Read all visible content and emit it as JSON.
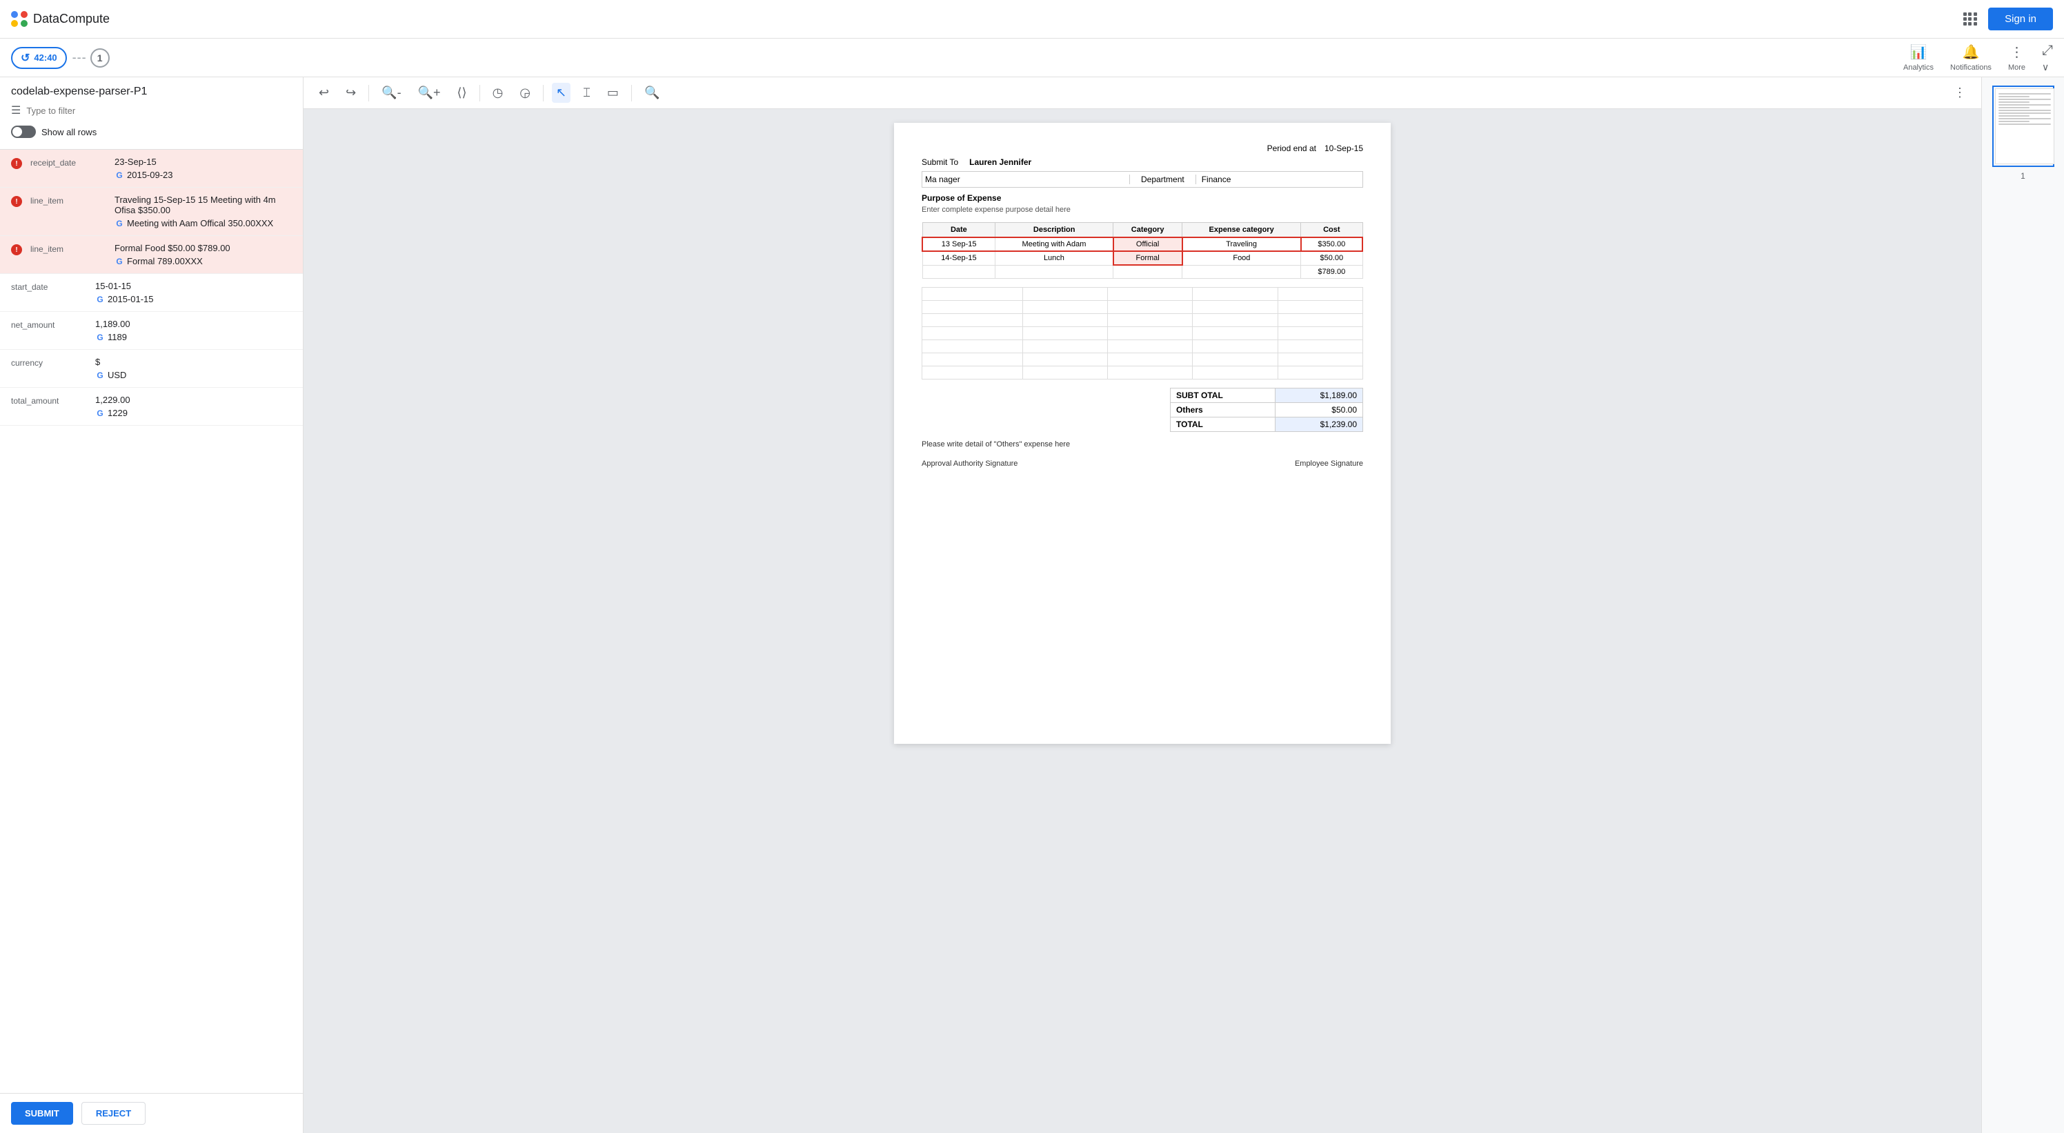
{
  "app": {
    "name": "DataCompute",
    "logo_colors": [
      "#4285f4",
      "#ea4335",
      "#fbbc04",
      "#34a853"
    ]
  },
  "top_nav": {
    "sign_in_label": "Sign in"
  },
  "sub_nav": {
    "timer": "42:40",
    "step": "1",
    "analytics_label": "Analytics",
    "notifications_label": "Notifications",
    "more_label": "More"
  },
  "left_panel": {
    "title": "codelab-expense-parser-P1",
    "filter_placeholder": "Type to filter",
    "show_all_label": "Show all rows",
    "fields": [
      {
        "key": "receipt_date",
        "label": "receipt_date",
        "raw": "23-Sep-15",
        "google": "2015-09-23",
        "has_error": true
      },
      {
        "key": "line_item_1",
        "label": "line_item",
        "raw": "Traveling 15-Sep-15 15 Meeting with 4m Ofisa $350.00",
        "google": "Meeting with Aam Offical 350.00XXX",
        "has_error": true
      },
      {
        "key": "line_item_2",
        "label": "line_item",
        "raw": "Formal Food $50.00 $789.00",
        "google": "Formal 789.00XXX",
        "has_error": true
      },
      {
        "key": "start_date",
        "label": "start_date",
        "raw": "15-01-15",
        "google": "2015-01-15",
        "has_error": false
      },
      {
        "key": "net_amount",
        "label": "net_amount",
        "raw": "1,189.00",
        "google": "1189",
        "has_error": false
      },
      {
        "key": "currency",
        "label": "currency",
        "raw": "$",
        "google": "USD",
        "has_error": false
      },
      {
        "key": "total_amount",
        "label": "total_amount",
        "raw": "1,229.00",
        "google": "1229",
        "has_error": false
      }
    ],
    "submit_label": "SUBMIT",
    "reject_label": "REJECT"
  },
  "doc": {
    "period_end_label": "Period end at",
    "period_end_value": "10-Sep-15",
    "submit_to_label": "Submit To",
    "submit_to_value": "Lauren Jennifer",
    "manager_label": "Ma nager",
    "department_label": "Department",
    "department_value": "Finance",
    "purpose_label": "Purpose of Expense",
    "purpose_hint": "Enter complete expense purpose detail here",
    "table_headers": [
      "Date",
      "Description",
      "Category",
      "Expense category",
      "Cost"
    ],
    "expense_rows": [
      {
        "date": "13 Sep-15",
        "description": "Meeting with Adam",
        "category": "Official",
        "expense_category": "Traveling",
        "cost": "$350.00",
        "highlight": true
      },
      {
        "date": "14-Sep-15",
        "description": "Lunch",
        "category": "Formal",
        "expense_category": "Food",
        "cost": "$50.00",
        "highlight": true
      },
      {
        "date": "",
        "description": "",
        "category": "",
        "expense_category": "",
        "cost": "$789.00",
        "highlight": false
      }
    ],
    "subtotal_label": "SUBT OTAL",
    "subtotal_value": "$1,189.00",
    "others_label": "Others",
    "others_value": "$50.00",
    "total_label": "TOTAL",
    "total_value": "$1,239.00",
    "others_hint": "Please write detail of \"Others\" expense here",
    "approval_label": "Approval Authority Signature",
    "employee_label": "Employee Signature"
  },
  "thumbnail": {
    "page_num": "1"
  }
}
